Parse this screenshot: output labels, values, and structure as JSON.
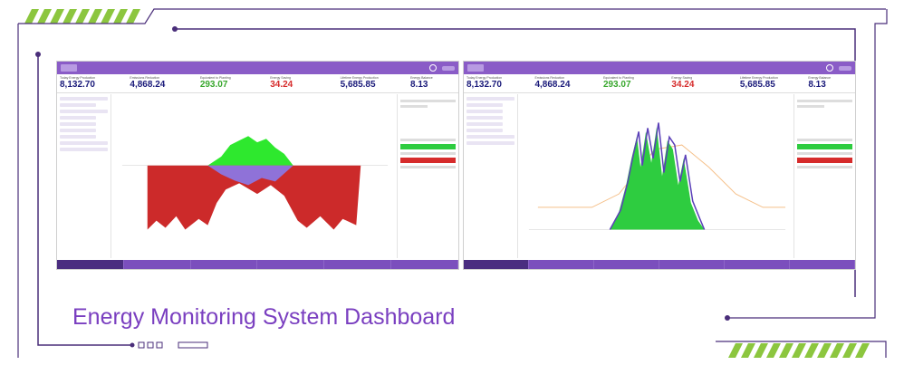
{
  "colors": {
    "accent_green": "#8cc63f",
    "frame_purple": "#4a2e7a",
    "title_purple": "#7a3fc0"
  },
  "caption": "Energy Monitoring System Dashboard",
  "screenshots": [
    {
      "stats": [
        {
          "label": "Today Energy Production",
          "value": "8,132.70",
          "color": "#1a1a7a"
        },
        {
          "label": "Emissions Reduction",
          "value": "4,868.24",
          "color": "#1a1a7a"
        },
        {
          "label": "Equivalent to Planting",
          "value": "293.07",
          "color": "#39a82e"
        },
        {
          "label": "Energy Saving",
          "value": "34.24",
          "color": "#d62b2b"
        },
        {
          "label": "Lifetime Energy Production",
          "value": "5,685.85",
          "color": "#1a1a7a"
        },
        {
          "label": "Energy Balance",
          "value": "8.13",
          "color": "#1a1a7a"
        }
      ]
    },
    {
      "stats": [
        {
          "label": "Today Energy Production",
          "value": "8,132.70",
          "color": "#1a1a7a"
        },
        {
          "label": "Emissions Reduction",
          "value": "4,868.24",
          "color": "#1a1a7a"
        },
        {
          "label": "Equivalent to Planting",
          "value": "293.07",
          "color": "#39a82e"
        },
        {
          "label": "Energy Saving",
          "value": "34.24",
          "color": "#d62b2b"
        },
        {
          "label": "Lifetime Energy Production",
          "value": "5,685.85",
          "color": "#1a1a7a"
        },
        {
          "label": "Energy Balance",
          "value": "8.13",
          "color": "#1a1a7a"
        }
      ]
    }
  ]
}
